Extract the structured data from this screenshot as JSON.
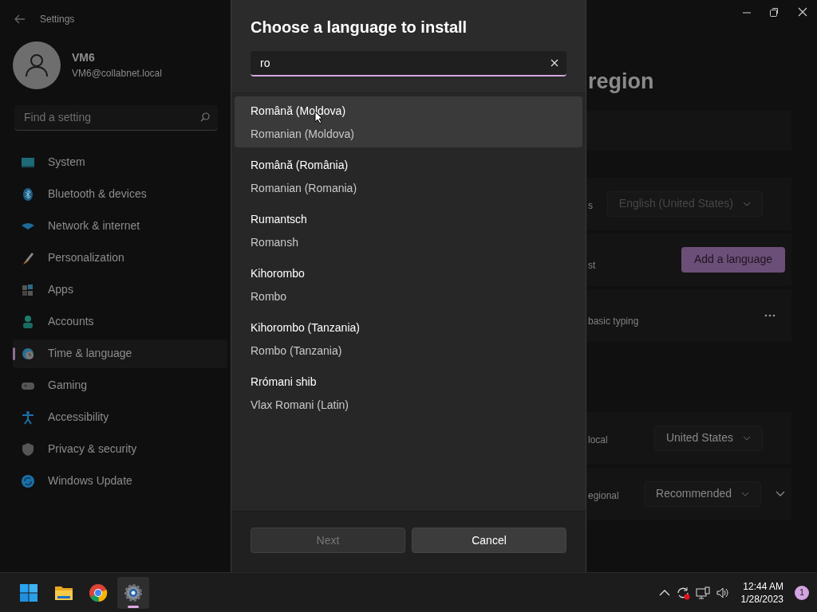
{
  "window": {
    "title": "Settings"
  },
  "account": {
    "name": "VM6",
    "email": "VM6@collabnet.local"
  },
  "search": {
    "placeholder": "Find a setting"
  },
  "nav_items": [
    {
      "label": "System",
      "selected": false
    },
    {
      "label": "Bluetooth & devices",
      "selected": false
    },
    {
      "label": "Network & internet",
      "selected": false
    },
    {
      "label": "Personalization",
      "selected": false
    },
    {
      "label": "Apps",
      "selected": false
    },
    {
      "label": "Accounts",
      "selected": false
    },
    {
      "label": "Time & language",
      "selected": true
    },
    {
      "label": "Gaming",
      "selected": false
    },
    {
      "label": "Accessibility",
      "selected": false
    },
    {
      "label": "Privacy & security",
      "selected": false
    },
    {
      "label": "Windows Update",
      "selected": false
    }
  ],
  "page": {
    "title": "region",
    "rows": [
      {
        "kind": "dropdown",
        "label": "s",
        "value": "English (United States)",
        "disabled": true
      },
      {
        "kind": "button",
        "label": "st",
        "value": "Add a language"
      },
      {
        "kind": "more",
        "label": "basic typing"
      },
      {
        "kind": "gap"
      },
      {
        "kind": "dropdown",
        "label": "local",
        "value": "United States",
        "disabled": false
      },
      {
        "kind": "dropdown-expand",
        "label": "egional",
        "value": "Recommended",
        "disabled": false
      }
    ]
  },
  "dialog": {
    "title": "Choose a language to install",
    "search": {
      "value": "ro"
    },
    "languages": [
      {
        "native": "Română (Moldova)",
        "english": "Romanian (Moldova)",
        "selected": true
      },
      {
        "native": "Română (România)",
        "english": "Romanian (Romania)",
        "selected": false
      },
      {
        "native": "Rumantsch",
        "english": "Romansh",
        "selected": false
      },
      {
        "native": "Kihorombo",
        "english": "Rombo",
        "selected": false
      },
      {
        "native": "Kihorombo (Tanzania)",
        "english": "Rombo (Tanzania)",
        "selected": false
      },
      {
        "native": "Rrómani shib",
        "english": "Vlax Romani (Latin)",
        "selected": false
      }
    ],
    "buttons": [
      {
        "label": "Next",
        "disabled": true
      },
      {
        "label": "Cancel",
        "disabled": false
      }
    ]
  },
  "taskbar": {
    "time": "12:44 AM",
    "date": "1/28/2023",
    "notifications": "1"
  }
}
